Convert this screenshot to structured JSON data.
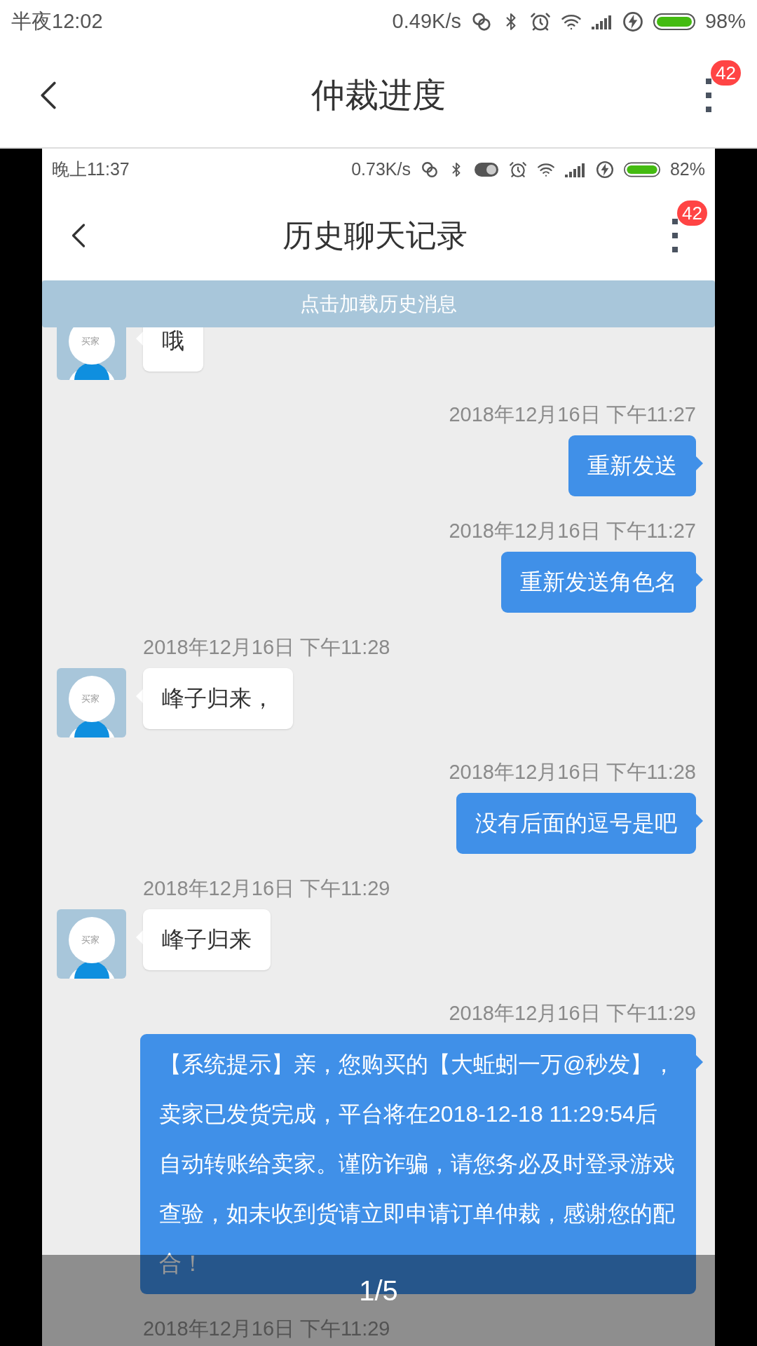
{
  "status_bar": {
    "time": "半夜12:02",
    "speed": "0.49K/s",
    "battery": "98%"
  },
  "header": {
    "title": "仲裁进度",
    "badge": "42"
  },
  "screenshot": {
    "status_bar": {
      "time": "晚上11:37",
      "speed": "0.73K/s",
      "battery": "82%"
    },
    "header": {
      "title": "历史聊天记录",
      "badge": "42"
    },
    "load_more": "点击加载历史消息",
    "messages": [
      {
        "kind": "received",
        "text": "哦",
        "avatar_label": "买家"
      },
      {
        "kind": "sent",
        "timestamp": "2018年12月16日 下午11:27",
        "text": "重新发送"
      },
      {
        "kind": "sent",
        "timestamp": "2018年12月16日 下午11:27",
        "text": "重新发送角色名"
      },
      {
        "kind": "received",
        "timestamp": "2018年12月16日 下午11:28",
        "text": "峰子归来，",
        "avatar_label": "买家"
      },
      {
        "kind": "sent",
        "timestamp": "2018年12月16日 下午11:28",
        "text": "没有后面的逗号是吧"
      },
      {
        "kind": "received",
        "timestamp": "2018年12月16日 下午11:29",
        "text": "峰子归来",
        "avatar_label": "买家"
      },
      {
        "kind": "sent",
        "timestamp": "2018年12月16日 下午11:29",
        "text": "【系统提示】亲，您购买的【大蚯蚓一万@秒发】，卖家已发货完成，平台将在2018-12-18 11:29:54后自动转账给卖家。谨防诈骗，请您务必及时登录游戏查验，如未收到货请立即申请订单仲裁，感谢您的配合！"
      },
      {
        "kind": "received",
        "timestamp": "2018年12月16日 下午11:29"
      }
    ]
  },
  "pager": "1/5"
}
